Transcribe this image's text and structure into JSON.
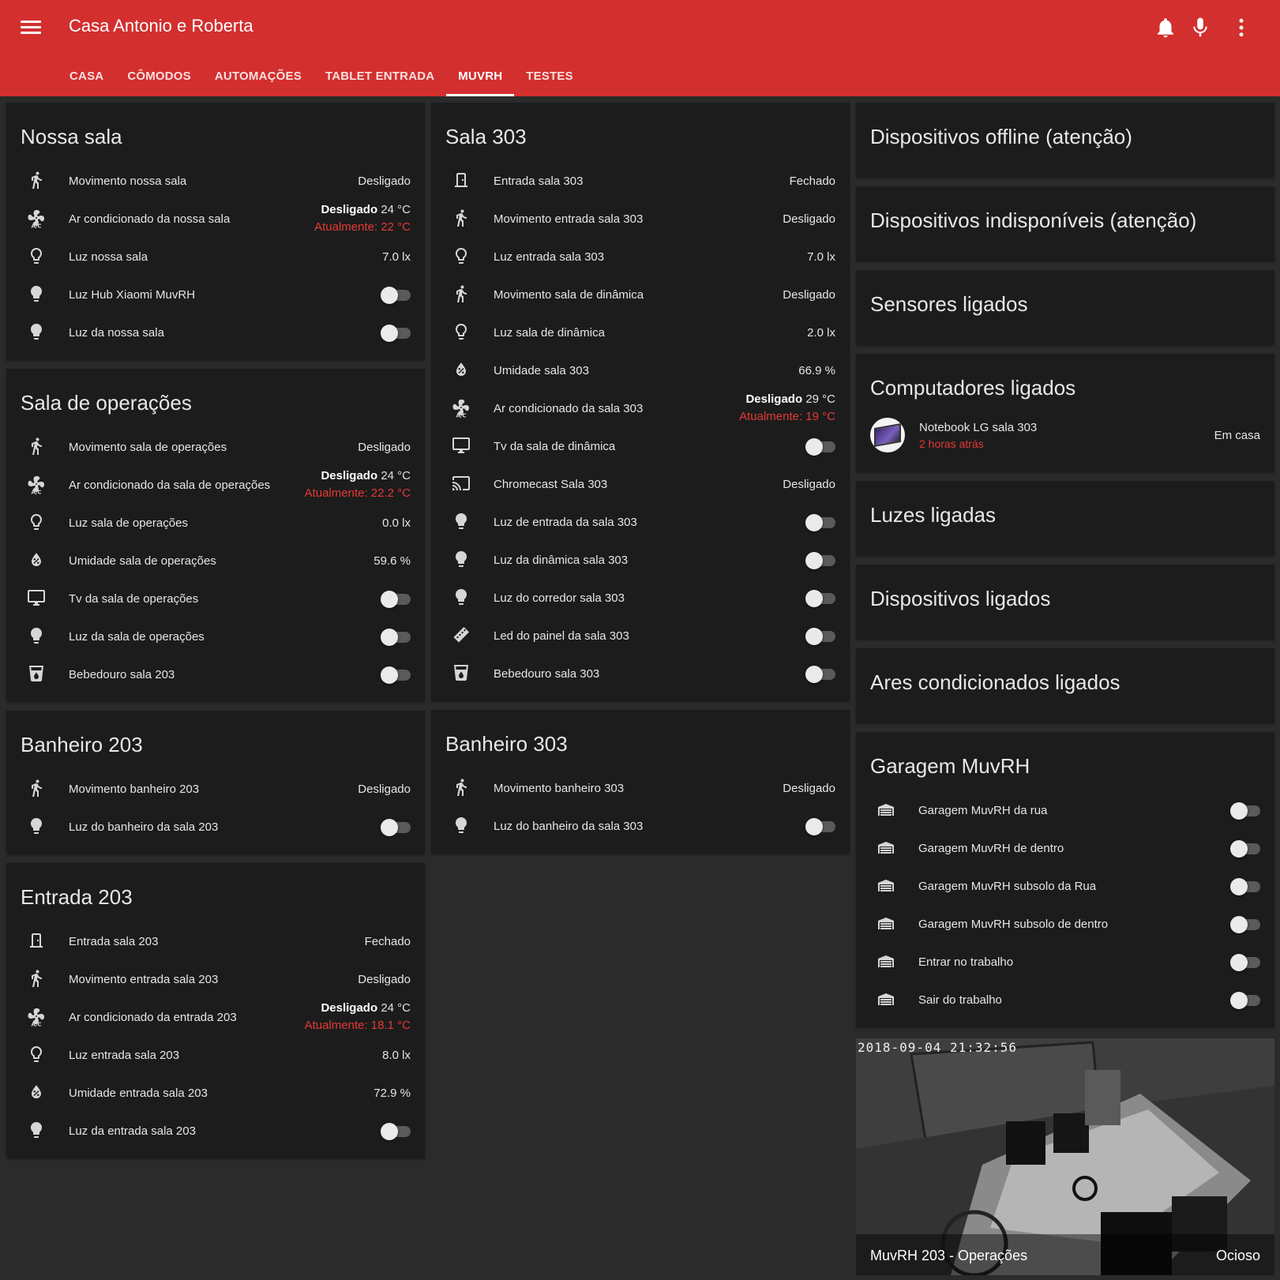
{
  "header": {
    "title": "Casa Antonio e Roberta",
    "tabs": [
      {
        "label": "CASA",
        "active": false
      },
      {
        "label": "CÔMODOS",
        "active": false
      },
      {
        "label": "AUTOMAÇÕES",
        "active": false
      },
      {
        "label": "TABLET ENTRADA",
        "active": false
      },
      {
        "label": "MUVRH",
        "active": true
      },
      {
        "label": "TESTES",
        "active": false
      }
    ],
    "accent_color": "#d32f2f"
  },
  "nossa_sala": {
    "title": "Nossa sala",
    "rows": [
      {
        "icon": "walk-icon",
        "name": "Movimento nossa sala",
        "state": "Desligado"
      },
      {
        "icon": "ac-icon",
        "name": "Ar condicionado da nossa sala",
        "state_bold": "Desligado",
        "target": "24 °C",
        "current": "Atualmente: 22 °C"
      },
      {
        "icon": "lightbulb-outline-icon",
        "name": "Luz nossa sala",
        "state": "7.0 lx"
      },
      {
        "icon": "lightbulb-icon",
        "name": "Luz Hub Xiaomi MuvRH",
        "toggle": "off"
      },
      {
        "icon": "lightbulb-icon",
        "name": "Luz da nossa sala",
        "toggle": "off"
      }
    ]
  },
  "sala_operacoes": {
    "title": "Sala de operações",
    "rows": [
      {
        "icon": "walk-icon",
        "name": "Movimento sala de operações",
        "state": "Desligado"
      },
      {
        "icon": "ac-icon",
        "name": "Ar condicionado da sala de operações",
        "state_bold": "Desligado",
        "target": "24 °C",
        "current": "Atualmente: 22.2 °C"
      },
      {
        "icon": "lightbulb-outline-icon",
        "name": "Luz sala de operações",
        "state": "0.0 lx"
      },
      {
        "icon": "water-percent-icon",
        "name": "Umidade sala de operações",
        "state": "59.6 %"
      },
      {
        "icon": "monitor-icon",
        "name": "Tv da sala de operações",
        "toggle": "off"
      },
      {
        "icon": "lightbulb-icon",
        "name": "Luz da sala de operações",
        "toggle": "off"
      },
      {
        "icon": "cup-water-icon",
        "name": "Bebedouro sala 203",
        "toggle": "off"
      }
    ]
  },
  "banheiro_203": {
    "title": "Banheiro 203",
    "rows": [
      {
        "icon": "walk-icon",
        "name": "Movimento banheiro 203",
        "state": "Desligado"
      },
      {
        "icon": "lightbulb-icon",
        "name": "Luz do banheiro da sala 203",
        "toggle": "off"
      }
    ]
  },
  "entrada_203": {
    "title": "Entrada 203",
    "rows": [
      {
        "icon": "door-icon",
        "name": "Entrada sala 203",
        "state": "Fechado"
      },
      {
        "icon": "walk-icon",
        "name": "Movimento entrada sala 203",
        "state": "Desligado"
      },
      {
        "icon": "ac-icon",
        "name": "Ar condicionado da entrada 203",
        "state_bold": "Desligado",
        "target": "24 °C",
        "current": "Atualmente: 18.1 °C"
      },
      {
        "icon": "lightbulb-outline-icon",
        "name": "Luz entrada sala 203",
        "state": "8.0 lx"
      },
      {
        "icon": "water-percent-icon",
        "name": "Umidade entrada sala 203",
        "state": "72.9 %"
      },
      {
        "icon": "lightbulb-icon",
        "name": "Luz da entrada sala 203",
        "toggle": "off"
      }
    ]
  },
  "sala_303": {
    "title": "Sala 303",
    "rows": [
      {
        "icon": "door-icon",
        "name": "Entrada sala 303",
        "state": "Fechado"
      },
      {
        "icon": "walk-icon",
        "name": "Movimento entrada sala 303",
        "state": "Desligado"
      },
      {
        "icon": "lightbulb-outline-icon",
        "name": "Luz entrada sala 303",
        "state": "7.0 lx"
      },
      {
        "icon": "walk-icon",
        "name": "Movimento sala de dinâmica",
        "state": "Desligado"
      },
      {
        "icon": "lightbulb-outline-icon",
        "name": "Luz sala de dinâmica",
        "state": "2.0 lx"
      },
      {
        "icon": "water-percent-icon",
        "name": "Umidade sala 303",
        "state": "66.9 %"
      },
      {
        "icon": "ac-icon",
        "name": "Ar condicionado da sala 303",
        "state_bold": "Desligado",
        "target": "29 °C",
        "current": "Atualmente: 19 °C"
      },
      {
        "icon": "monitor-icon",
        "name": "Tv da sala de dinâmica",
        "toggle": "off"
      },
      {
        "icon": "cast-icon",
        "name": "Chromecast Sala 303",
        "state": "Desligado"
      },
      {
        "icon": "lightbulb-icon",
        "name": "Luz de entrada da sala 303",
        "toggle": "off"
      },
      {
        "icon": "lightbulb-icon",
        "name": "Luz da dinâmica sala 303",
        "toggle": "off"
      },
      {
        "icon": "lightbulb-icon",
        "name": "Luz do corredor sala 303",
        "toggle": "off"
      },
      {
        "icon": "led-strip-icon",
        "name": "Led do painel da sala 303",
        "toggle": "off"
      },
      {
        "icon": "cup-water-icon",
        "name": "Bebedouro sala 303",
        "toggle": "off"
      }
    ]
  },
  "banheiro_303": {
    "title": "Banheiro 303",
    "rows": [
      {
        "icon": "walk-icon",
        "name": "Movimento banheiro 303",
        "state": "Desligado"
      },
      {
        "icon": "lightbulb-icon",
        "name": "Luz do banheiro da sala 303",
        "toggle": "off"
      }
    ]
  },
  "groups": {
    "offline": "Dispositivos offline (atenção)",
    "indisponiveis": "Dispositivos indisponíveis (atenção)",
    "sensores": "Sensores ligados",
    "computadores": "Computadores ligados",
    "luzes": "Luzes ligadas",
    "dispositivos": "Dispositivos ligados",
    "ares": "Ares condicionados ligados"
  },
  "computer": {
    "name": "Notebook LG sala 303",
    "last_seen": "2 horas atrás",
    "state": "Em casa"
  },
  "garagem": {
    "title": "Garagem MuvRH",
    "rows": [
      {
        "icon": "garage-icon",
        "name": "Garagem MuvRH da rua",
        "toggle": "off"
      },
      {
        "icon": "garage-icon",
        "name": "Garagem MuvRH de dentro",
        "toggle": "off"
      },
      {
        "icon": "garage-icon",
        "name": "Garagem MuvRH subsolo da Rua",
        "toggle": "off"
      },
      {
        "icon": "garage-icon",
        "name": "Garagem MuvRH subsolo de dentro",
        "toggle": "off"
      },
      {
        "icon": "garage-icon",
        "name": "Entrar no trabalho",
        "toggle": "off"
      },
      {
        "icon": "garage-icon",
        "name": "Sair do trabalho",
        "toggle": "off"
      }
    ]
  },
  "camera": {
    "timestamp": "2018-09-04  21:32:56",
    "name": "MuvRH 203 - Operações",
    "state": "Ocioso"
  }
}
